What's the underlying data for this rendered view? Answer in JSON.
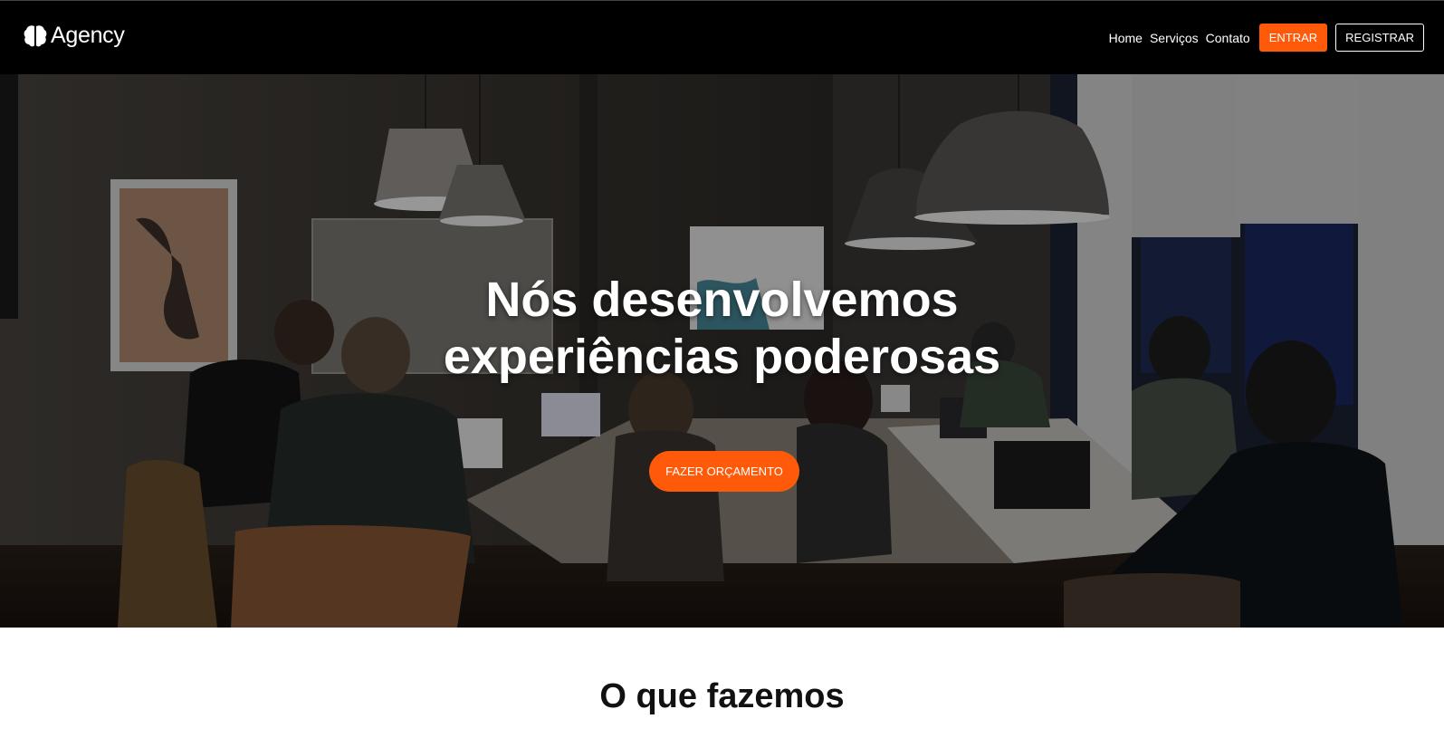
{
  "header": {
    "brand_name": "Agency",
    "nav": [
      "Home",
      "Serviços",
      "Contato"
    ],
    "login_label": "ENTRAR",
    "register_label": "REGISTRAR"
  },
  "hero": {
    "title_line1": "Nós desenvolvemos",
    "title_line2": "experiências poderosas",
    "cta_label": "FAZER ORÇAMENTO"
  },
  "section": {
    "title": "O que fazemos"
  },
  "colors": {
    "accent": "#ff5a0a",
    "header_bg": "#000000",
    "page_bg": "#ffffff"
  }
}
